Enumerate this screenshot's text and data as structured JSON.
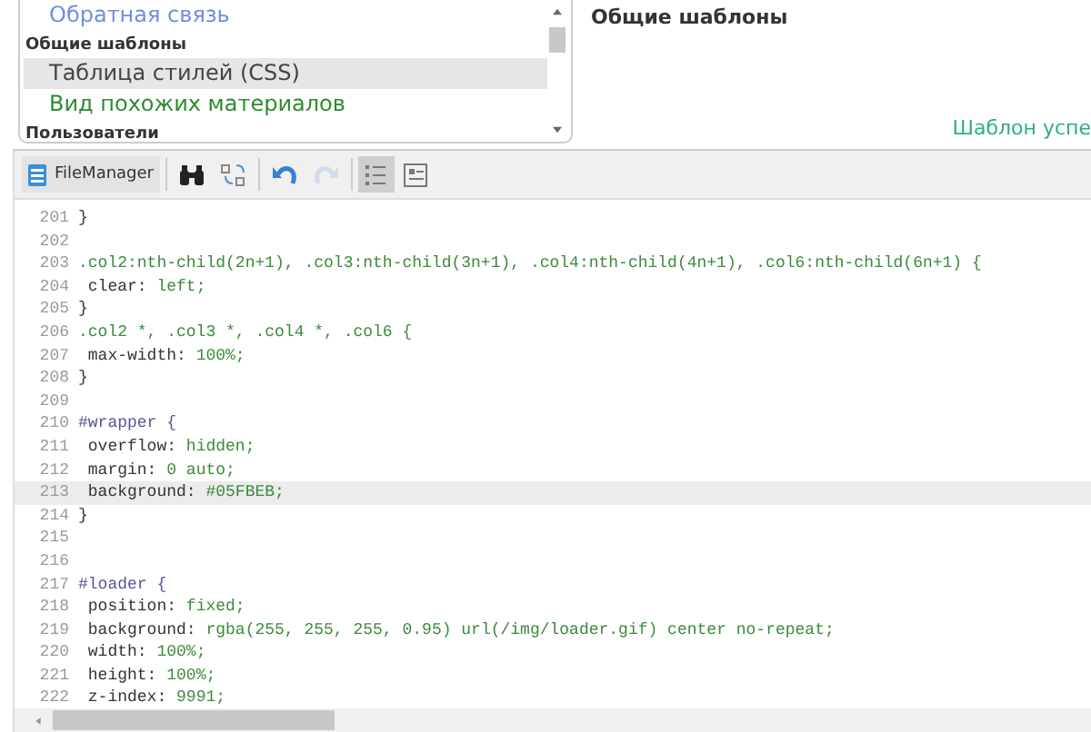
{
  "template_list": {
    "entries": [
      {
        "kind": "item",
        "label": "Обратная связь",
        "color": "#6d8fe0",
        "selected": false
      },
      {
        "kind": "group",
        "label": "Общие шаблоны"
      },
      {
        "kind": "item",
        "label": "Таблица стилей (CSS)",
        "color": "#444444",
        "selected": true
      },
      {
        "kind": "item",
        "label": "Вид похожих материалов",
        "color": "#2e8b2e",
        "selected": false
      },
      {
        "kind": "group",
        "label": "Пользователи"
      }
    ]
  },
  "panel": {
    "heading": "Общие шаблоны",
    "status": "Шаблон успе"
  },
  "toolbar": {
    "buttons": [
      {
        "kind": "filemanager",
        "label": "FileManager",
        "active": false,
        "disabled": false
      },
      {
        "kind": "search",
        "active": false,
        "disabled": false
      },
      {
        "kind": "replace",
        "active": false,
        "disabled": false
      },
      {
        "kind": "undo",
        "active": false,
        "disabled": false
      },
      {
        "kind": "redo",
        "active": false,
        "disabled": true
      },
      {
        "kind": "linenumbers",
        "active": true,
        "disabled": false
      },
      {
        "kind": "fullscreen",
        "active": false,
        "disabled": false
      }
    ]
  },
  "editor": {
    "lines": [
      {
        "number": "201",
        "kind": "text",
        "text": "}",
        "selected": false
      },
      {
        "number": "202",
        "kind": "blank",
        "selected": false
      },
      {
        "number": "203",
        "kind": "selector",
        "text": ".col2:nth-child(2n+1), .col3:nth-child(3n+1), .col4:nth-child(4n+1), .col6:nth-child(6n+1) {",
        "selected": false
      },
      {
        "number": "204",
        "kind": "decl",
        "prop": " clear:",
        "value": "left;",
        "selected": false
      },
      {
        "number": "205",
        "kind": "text",
        "text": "}",
        "selected": false
      },
      {
        "number": "206",
        "kind": "selector",
        "text": ".col2 *, .col3 *, .col4 *, .col6 {",
        "selected": false
      },
      {
        "number": "207",
        "kind": "decl",
        "prop": " max-width:",
        "value": "100%;",
        "selected": false
      },
      {
        "number": "208",
        "kind": "text",
        "text": "}",
        "selected": false
      },
      {
        "number": "209",
        "kind": "blank",
        "selected": false
      },
      {
        "number": "210",
        "kind": "id",
        "text": "#wrapper {",
        "selected": false
      },
      {
        "number": "211",
        "kind": "decl",
        "prop": " overflow:",
        "value": "hidden;",
        "selected": false
      },
      {
        "number": "212",
        "kind": "decl",
        "prop": " margin:",
        "value": "0 auto;",
        "selected": false
      },
      {
        "number": "213",
        "kind": "decl",
        "prop": " background:",
        "value": "#05FBEB;",
        "selected": true
      },
      {
        "number": "214",
        "kind": "text",
        "text": "}",
        "selected": false
      },
      {
        "number": "215",
        "kind": "blank",
        "selected": false
      },
      {
        "number": "216",
        "kind": "blank",
        "selected": false
      },
      {
        "number": "217",
        "kind": "id",
        "text": "#loader {",
        "selected": false
      },
      {
        "number": "218",
        "kind": "decl",
        "prop": " position:",
        "value": "fixed;",
        "selected": false
      },
      {
        "number": "219",
        "kind": "decl",
        "prop": " background:",
        "value": "rgba(255, 255, 255, 0.95) url(/img/loader.gif) center no-repeat;",
        "selected": false
      },
      {
        "number": "220",
        "kind": "decl",
        "prop": " width:",
        "value": "100%;",
        "selected": false
      },
      {
        "number": "221",
        "kind": "decl",
        "prop": " height:",
        "value": "100%;",
        "selected": false
      },
      {
        "number": "222",
        "kind": "decl",
        "prop": " z-index:",
        "value": "9991;",
        "selected": false
      }
    ]
  }
}
